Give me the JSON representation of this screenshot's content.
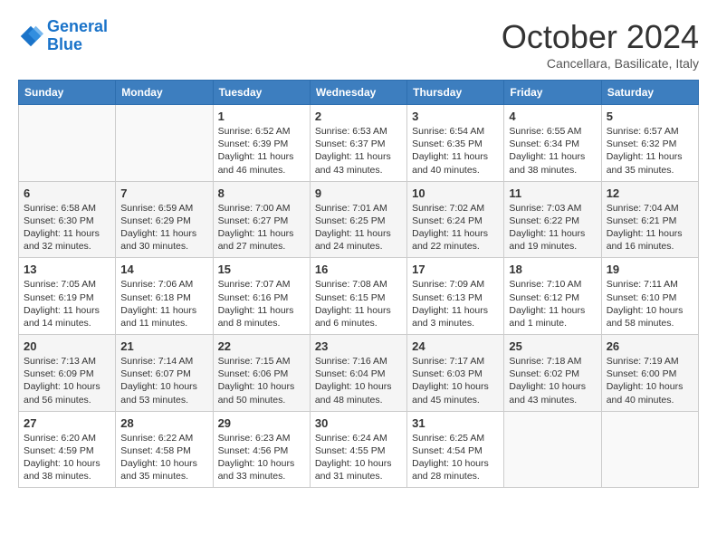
{
  "header": {
    "logo_line1": "General",
    "logo_line2": "Blue",
    "month": "October 2024",
    "location": "Cancellara, Basilicate, Italy"
  },
  "weekdays": [
    "Sunday",
    "Monday",
    "Tuesday",
    "Wednesday",
    "Thursday",
    "Friday",
    "Saturday"
  ],
  "weeks": [
    [
      {
        "day": "",
        "detail": ""
      },
      {
        "day": "",
        "detail": ""
      },
      {
        "day": "1",
        "detail": "Sunrise: 6:52 AM\nSunset: 6:39 PM\nDaylight: 11 hours and 46 minutes."
      },
      {
        "day": "2",
        "detail": "Sunrise: 6:53 AM\nSunset: 6:37 PM\nDaylight: 11 hours and 43 minutes."
      },
      {
        "day": "3",
        "detail": "Sunrise: 6:54 AM\nSunset: 6:35 PM\nDaylight: 11 hours and 40 minutes."
      },
      {
        "day": "4",
        "detail": "Sunrise: 6:55 AM\nSunset: 6:34 PM\nDaylight: 11 hours and 38 minutes."
      },
      {
        "day": "5",
        "detail": "Sunrise: 6:57 AM\nSunset: 6:32 PM\nDaylight: 11 hours and 35 minutes."
      }
    ],
    [
      {
        "day": "6",
        "detail": "Sunrise: 6:58 AM\nSunset: 6:30 PM\nDaylight: 11 hours and 32 minutes."
      },
      {
        "day": "7",
        "detail": "Sunrise: 6:59 AM\nSunset: 6:29 PM\nDaylight: 11 hours and 30 minutes."
      },
      {
        "day": "8",
        "detail": "Sunrise: 7:00 AM\nSunset: 6:27 PM\nDaylight: 11 hours and 27 minutes."
      },
      {
        "day": "9",
        "detail": "Sunrise: 7:01 AM\nSunset: 6:25 PM\nDaylight: 11 hours and 24 minutes."
      },
      {
        "day": "10",
        "detail": "Sunrise: 7:02 AM\nSunset: 6:24 PM\nDaylight: 11 hours and 22 minutes."
      },
      {
        "day": "11",
        "detail": "Sunrise: 7:03 AM\nSunset: 6:22 PM\nDaylight: 11 hours and 19 minutes."
      },
      {
        "day": "12",
        "detail": "Sunrise: 7:04 AM\nSunset: 6:21 PM\nDaylight: 11 hours and 16 minutes."
      }
    ],
    [
      {
        "day": "13",
        "detail": "Sunrise: 7:05 AM\nSunset: 6:19 PM\nDaylight: 11 hours and 14 minutes."
      },
      {
        "day": "14",
        "detail": "Sunrise: 7:06 AM\nSunset: 6:18 PM\nDaylight: 11 hours and 11 minutes."
      },
      {
        "day": "15",
        "detail": "Sunrise: 7:07 AM\nSunset: 6:16 PM\nDaylight: 11 hours and 8 minutes."
      },
      {
        "day": "16",
        "detail": "Sunrise: 7:08 AM\nSunset: 6:15 PM\nDaylight: 11 hours and 6 minutes."
      },
      {
        "day": "17",
        "detail": "Sunrise: 7:09 AM\nSunset: 6:13 PM\nDaylight: 11 hours and 3 minutes."
      },
      {
        "day": "18",
        "detail": "Sunrise: 7:10 AM\nSunset: 6:12 PM\nDaylight: 11 hours and 1 minute."
      },
      {
        "day": "19",
        "detail": "Sunrise: 7:11 AM\nSunset: 6:10 PM\nDaylight: 10 hours and 58 minutes."
      }
    ],
    [
      {
        "day": "20",
        "detail": "Sunrise: 7:13 AM\nSunset: 6:09 PM\nDaylight: 10 hours and 56 minutes."
      },
      {
        "day": "21",
        "detail": "Sunrise: 7:14 AM\nSunset: 6:07 PM\nDaylight: 10 hours and 53 minutes."
      },
      {
        "day": "22",
        "detail": "Sunrise: 7:15 AM\nSunset: 6:06 PM\nDaylight: 10 hours and 50 minutes."
      },
      {
        "day": "23",
        "detail": "Sunrise: 7:16 AM\nSunset: 6:04 PM\nDaylight: 10 hours and 48 minutes."
      },
      {
        "day": "24",
        "detail": "Sunrise: 7:17 AM\nSunset: 6:03 PM\nDaylight: 10 hours and 45 minutes."
      },
      {
        "day": "25",
        "detail": "Sunrise: 7:18 AM\nSunset: 6:02 PM\nDaylight: 10 hours and 43 minutes."
      },
      {
        "day": "26",
        "detail": "Sunrise: 7:19 AM\nSunset: 6:00 PM\nDaylight: 10 hours and 40 minutes."
      }
    ],
    [
      {
        "day": "27",
        "detail": "Sunrise: 6:20 AM\nSunset: 4:59 PM\nDaylight: 10 hours and 38 minutes."
      },
      {
        "day": "28",
        "detail": "Sunrise: 6:22 AM\nSunset: 4:58 PM\nDaylight: 10 hours and 35 minutes."
      },
      {
        "day": "29",
        "detail": "Sunrise: 6:23 AM\nSunset: 4:56 PM\nDaylight: 10 hours and 33 minutes."
      },
      {
        "day": "30",
        "detail": "Sunrise: 6:24 AM\nSunset: 4:55 PM\nDaylight: 10 hours and 31 minutes."
      },
      {
        "day": "31",
        "detail": "Sunrise: 6:25 AM\nSunset: 4:54 PM\nDaylight: 10 hours and 28 minutes."
      },
      {
        "day": "",
        "detail": ""
      },
      {
        "day": "",
        "detail": ""
      }
    ]
  ]
}
